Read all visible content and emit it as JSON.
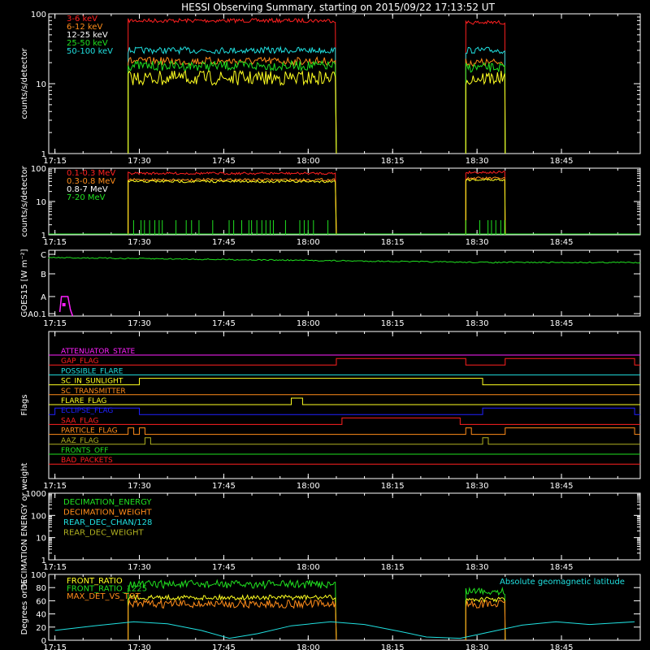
{
  "title": "HESSI Observing Summary, starting on 2015/09/22 17:13:52 UT",
  "colors": {
    "bg": "#000000",
    "axis": "#ffffff"
  },
  "chart_data": [
    {
      "type": "line",
      "name": "panel-count-rates-low",
      "ylabel": "counts/s/detector",
      "yscale": "log",
      "ylim": [
        1,
        100
      ],
      "yticks": [
        "1",
        "10",
        "100"
      ],
      "xticks": [
        "17:15",
        "17:30",
        "17:45",
        "18:00",
        "18:15",
        "18:30",
        "18:45"
      ],
      "legend": [
        {
          "label": "3-6 keV",
          "color": "#ff2020"
        },
        {
          "label": "6-12 keV",
          "color": "#ff8c1a"
        },
        {
          "label": "12-25 keV",
          "color": "#ffffff"
        },
        {
          "label": "25-50 keV",
          "color": "#20e020"
        },
        {
          "label": "50-100 keV",
          "color": "#20e0e0"
        }
      ],
      "series": [
        {
          "label": "3-6 keV",
          "color": "#ff2020",
          "segments": [
            {
              "start": "17:28",
              "end": "18:05",
              "value": 80
            },
            {
              "start": "18:28",
              "end": "18:35",
              "value": 75
            }
          ]
        },
        {
          "label": "50-100 keV",
          "color": "#20e0e0",
          "segments": [
            {
              "start": "17:28",
              "end": "18:05",
              "value": 30
            },
            {
              "start": "18:28",
              "end": "18:35",
              "value": 30
            }
          ]
        },
        {
          "label": "6-12 keV",
          "color": "#ff8c1a",
          "segments": [
            {
              "start": "17:28",
              "end": "18:05",
              "value": 21
            },
            {
              "start": "18:28",
              "end": "18:35",
              "value": 20
            }
          ]
        },
        {
          "label": "25-50 keV",
          "color": "#20e020",
          "segments": [
            {
              "start": "17:28",
              "end": "18:05",
              "value": 18
            },
            {
              "start": "18:28",
              "end": "18:35",
              "value": 17
            }
          ]
        },
        {
          "label": "12-25 keV",
          "color": "#ffff20",
          "segments": [
            {
              "start": "17:28",
              "end": "18:05",
              "value": 12
            },
            {
              "start": "18:28",
              "end": "18:35",
              "value": 12
            }
          ]
        }
      ]
    },
    {
      "type": "line",
      "name": "panel-count-rates-high",
      "ylabel": "counts/s/detector",
      "yscale": "log",
      "ylim": [
        1,
        100
      ],
      "yticks": [
        "1",
        "10",
        "100"
      ],
      "xticks": [
        "17:15",
        "17:30",
        "17:45",
        "18:00",
        "18:15",
        "18:30",
        "18:45"
      ],
      "legend": [
        {
          "label": "0.1-0.3 MeV",
          "color": "#ff2020"
        },
        {
          "label": "0.3-0.8 MeV",
          "color": "#ff8c1a"
        },
        {
          "label": "0.8-7 MeV",
          "color": "#ffffff"
        },
        {
          "label": "7-20 MeV",
          "color": "#20e020"
        }
      ],
      "series": [
        {
          "label": "0.1-0.3 MeV",
          "color": "#ff2020",
          "segments": [
            {
              "start": "17:28",
              "end": "18:05",
              "value": 70
            },
            {
              "start": "18:28",
              "end": "18:35",
              "value": 75
            }
          ]
        },
        {
          "label": "0.3-0.8 MeV",
          "color": "#ff8c1a",
          "segments": [
            {
              "start": "17:28",
              "end": "18:05",
              "value": 45
            },
            {
              "start": "18:28",
              "end": "18:35",
              "value": 50
            }
          ]
        },
        {
          "label": "0.8-7 MeV",
          "color": "#ffff20",
          "segments": [
            {
              "start": "17:28",
              "end": "18:05",
              "value": 40
            },
            {
              "start": "18:28",
              "end": "18:35",
              "value": 45
            }
          ]
        },
        {
          "label": "7-20 MeV",
          "color": "#20e020",
          "segments": [
            {
              "start": "17:28",
              "end": "18:05",
              "value": 1.05
            },
            {
              "start": "18:28",
              "end": "18:35",
              "value": 1.05
            }
          ]
        }
      ]
    },
    {
      "type": "line",
      "name": "panel-goes",
      "ylabel": "GOES15 [W m⁻²]",
      "yticks": [
        "A0.1",
        "A",
        "B",
        "C"
      ],
      "xticks": [
        "17:15",
        "17:30",
        "17:45",
        "18:00",
        "18:15",
        "18:30",
        "18:45"
      ],
      "series": [
        {
          "label": "GOES long",
          "color": "#20e020",
          "level_start": "C",
          "trend": "slightly decreasing"
        },
        {
          "label": "GOES short",
          "color": "#ff20ff",
          "visible_range": [
            "17:15",
            "17:17"
          ],
          "level": "A"
        }
      ]
    },
    {
      "type": "line",
      "name": "panel-flags",
      "ylabel": "Flags",
      "xticks": [
        "17:15",
        "17:30",
        "17:45",
        "18:00",
        "18:15",
        "18:30",
        "18:45"
      ],
      "flags": [
        {
          "label": "ATTENUATOR_STATE",
          "color": "#ff20ff",
          "on": []
        },
        {
          "label": "GAP_FLAG",
          "color": "#ff2020",
          "on": [
            [
              "18:05",
              "18:28"
            ],
            [
              "18:35",
              "18:58"
            ]
          ]
        },
        {
          "label": "POSSIBLE_FLARE",
          "color": "#20e0e0",
          "on": []
        },
        {
          "label": "SC_IN_SUNLIGHT",
          "color": "#ffff20",
          "on": [
            [
              "17:30",
              "18:31"
            ]
          ]
        },
        {
          "label": "SC_TRANSMITTER",
          "color": "#ff8c1a",
          "on": []
        },
        {
          "label": "FLARE_FLAG",
          "color": "#ffff20",
          "on": [
            [
              "17:57",
              "17:59"
            ]
          ]
        },
        {
          "label": "ECLIPSE_FLAG",
          "color": "#2020ff",
          "on": [
            [
              "17:15",
              "17:30"
            ],
            [
              "18:31",
              "18:58"
            ]
          ]
        },
        {
          "label": "SAA_FLAG",
          "color": "#ff2020",
          "on": [
            [
              "18:06",
              "18:27"
            ]
          ]
        },
        {
          "label": "PARTICLE_FLAG",
          "color": "#ff8c1a",
          "on": [
            [
              "17:28",
              "17:29"
            ],
            [
              "17:30",
              "17:31"
            ],
            [
              "18:28",
              "18:29"
            ],
            [
              "18:35",
              "18:58"
            ]
          ]
        },
        {
          "label": "AAZ_FLAG",
          "color": "#b0b020",
          "on": [
            [
              "17:31",
              "17:32"
            ],
            [
              "18:31",
              "18:32"
            ]
          ]
        },
        {
          "label": "FRONTS_OFF",
          "color": "#20e020",
          "on": []
        },
        {
          "label": "BAD_PACKETS",
          "color": "#ff2020",
          "on": []
        }
      ]
    },
    {
      "type": "line",
      "name": "panel-decimation",
      "ylabel": "DECIMATION ENERGY or weight",
      "yscale": "log",
      "ylim": [
        1,
        1000
      ],
      "yticks": [
        "1",
        "10",
        "100",
        "1000"
      ],
      "xticks": [
        "17:15",
        "17:30",
        "17:45",
        "18:00",
        "18:15",
        "18:30",
        "18:45"
      ],
      "legend": [
        {
          "label": "DECIMATION_ENERGY",
          "color": "#20e020"
        },
        {
          "label": "DECIMATION_WEIGHT",
          "color": "#ff8c1a"
        },
        {
          "label": "REAR_DEC_CHAN/128",
          "color": "#20e0e0"
        },
        {
          "label": "REAR_DEC_WEIGHT",
          "color": "#b0b020"
        }
      ]
    },
    {
      "type": "line",
      "name": "panel-ratios",
      "ylabel": "Degrees or %",
      "ylim": [
        0,
        100
      ],
      "yticks": [
        "0",
        "20",
        "40",
        "60",
        "80",
        "100"
      ],
      "xticks": [
        "17:15",
        "17:30",
        "17:45",
        "18:00",
        "18:15",
        "18:30",
        "18:45"
      ],
      "legend": [
        {
          "label": "FRONT_RATIO",
          "color": "#ffff20"
        },
        {
          "label": "FRONT_RATIO_1225",
          "color": "#20e020"
        },
        {
          "label": "MAX_DET_VS_TOT",
          "color": "#ff8c1a"
        }
      ],
      "annotation": {
        "label": "Absolute geomagnetic latitude",
        "color": "#20e0e0"
      },
      "series": [
        {
          "label": "FRONT_RATIO_1225",
          "color": "#20e020",
          "segments": [
            {
              "start": "17:28",
              "end": "18:05",
              "value": 85
            },
            {
              "start": "18:28",
              "end": "18:35",
              "value": 75
            }
          ]
        },
        {
          "label": "FRONT_RATIO",
          "color": "#ffff20",
          "segments": [
            {
              "start": "17:28",
              "end": "18:05",
              "value": 65
            },
            {
              "start": "18:28",
              "end": "18:35",
              "value": 62
            }
          ]
        },
        {
          "label": "MAX_DET_VS_TOT",
          "color": "#ff8c1a",
          "segments": [
            {
              "start": "17:28",
              "end": "18:05",
              "value": 55
            },
            {
              "start": "18:28",
              "end": "18:35",
              "value": 55
            }
          ]
        },
        {
          "label": "Absolute geomagnetic latitude",
          "color": "#20e0e0",
          "x": [
            "17:15",
            "17:22",
            "17:29",
            "17:35",
            "17:41",
            "17:46",
            "17:51",
            "17:57",
            "18:04",
            "18:10",
            "18:16",
            "18:21",
            "18:27",
            "18:33",
            "18:38",
            "18:44",
            "18:50",
            "18:58"
          ],
          "y": [
            15,
            22,
            28,
            25,
            15,
            3,
            10,
            22,
            28,
            24,
            14,
            5,
            3,
            14,
            23,
            28,
            24,
            28
          ]
        }
      ]
    }
  ]
}
